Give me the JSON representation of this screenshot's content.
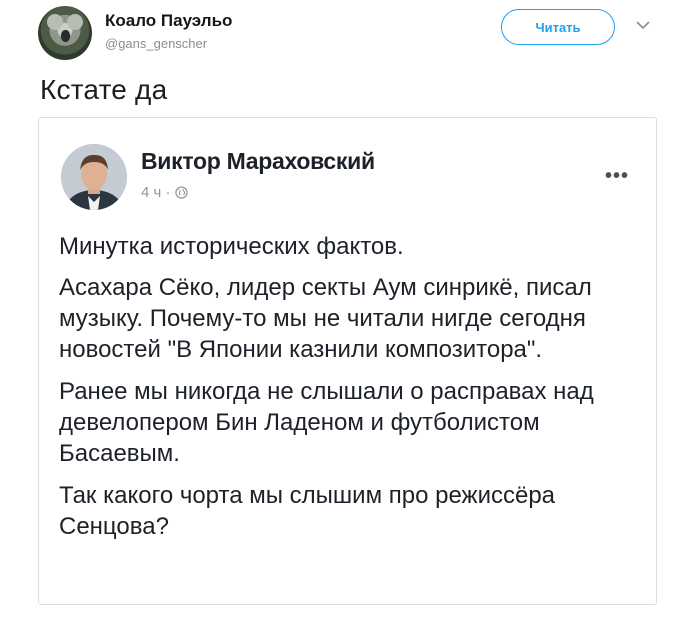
{
  "tweet": {
    "author": {
      "display_name": "Коало Пауэльо",
      "handle": "@gans_genscher",
      "avatar_icon": "koala-avatar"
    },
    "follow_label": "Читать",
    "menu_icon": "chevron-down-icon",
    "text": "Кстате да"
  },
  "quoted_post": {
    "author": {
      "name": "Виктор Мараховский",
      "avatar_icon": "person-avatar"
    },
    "meta": {
      "time": "4 ч ·",
      "privacy_icon": "globe-icon"
    },
    "more_icon": "more-icon",
    "paragraphs": [
      "Минутка исторических фактов.",
      "Асахара Сёко, лидер секты Аум синрикё, писал музыку. Почему-то мы не читали нигде сегодня новостей \"В Японии казнили композитора\".",
      "Ранее мы никогда не слышали о расправах над девелопером Бин Ладеном и футболистом Басаевым.",
      "Так какого чорта мы слышим про режиссёра Сенцова?"
    ]
  },
  "colors": {
    "accent": "#1da1f2",
    "text": "#14171a",
    "muted": "#90949c",
    "border": "#dadde1"
  }
}
